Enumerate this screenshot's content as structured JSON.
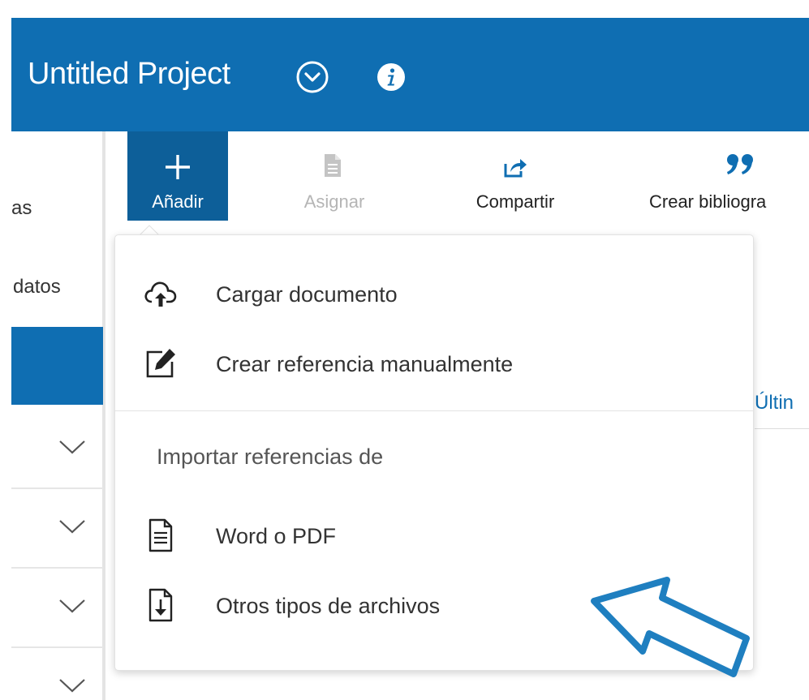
{
  "header": {
    "title": "Untitled Project",
    "background_color": "#0f6eb2",
    "dropdown_icon": "chevron-down-circle-icon",
    "info_icon": "info-icon"
  },
  "sidebar": {
    "items": [
      {
        "label": "as"
      },
      {
        "label": "datos"
      }
    ],
    "active_color": "#0f6eb2",
    "expander_icon": "chevron-down-icon"
  },
  "toolbar": {
    "buttons": [
      {
        "label": "Añadir",
        "icon": "plus-icon",
        "state": "active"
      },
      {
        "label": "Asignar",
        "icon": "document-icon",
        "state": "disabled"
      },
      {
        "label": "Compartir",
        "icon": "share-icon",
        "state": "normal"
      },
      {
        "label": "Crear bibliogra",
        "icon": "quote-icon",
        "state": "normal"
      }
    ]
  },
  "add_menu": {
    "items": [
      {
        "label": "Cargar documento",
        "icon": "cloud-upload-icon"
      },
      {
        "label": "Crear referencia manualmente",
        "icon": "edit-icon"
      }
    ],
    "import_section": {
      "title": "Importar referencias de",
      "items": [
        {
          "label": "Word o PDF",
          "icon": "file-text-icon"
        },
        {
          "label": "Otros tipos de archivos",
          "icon": "file-download-icon"
        }
      ]
    }
  },
  "background": {
    "partial_text": "Últin"
  },
  "annotation": {
    "icon": "pointer-arrow-icon",
    "color": "#1f7fc0"
  }
}
